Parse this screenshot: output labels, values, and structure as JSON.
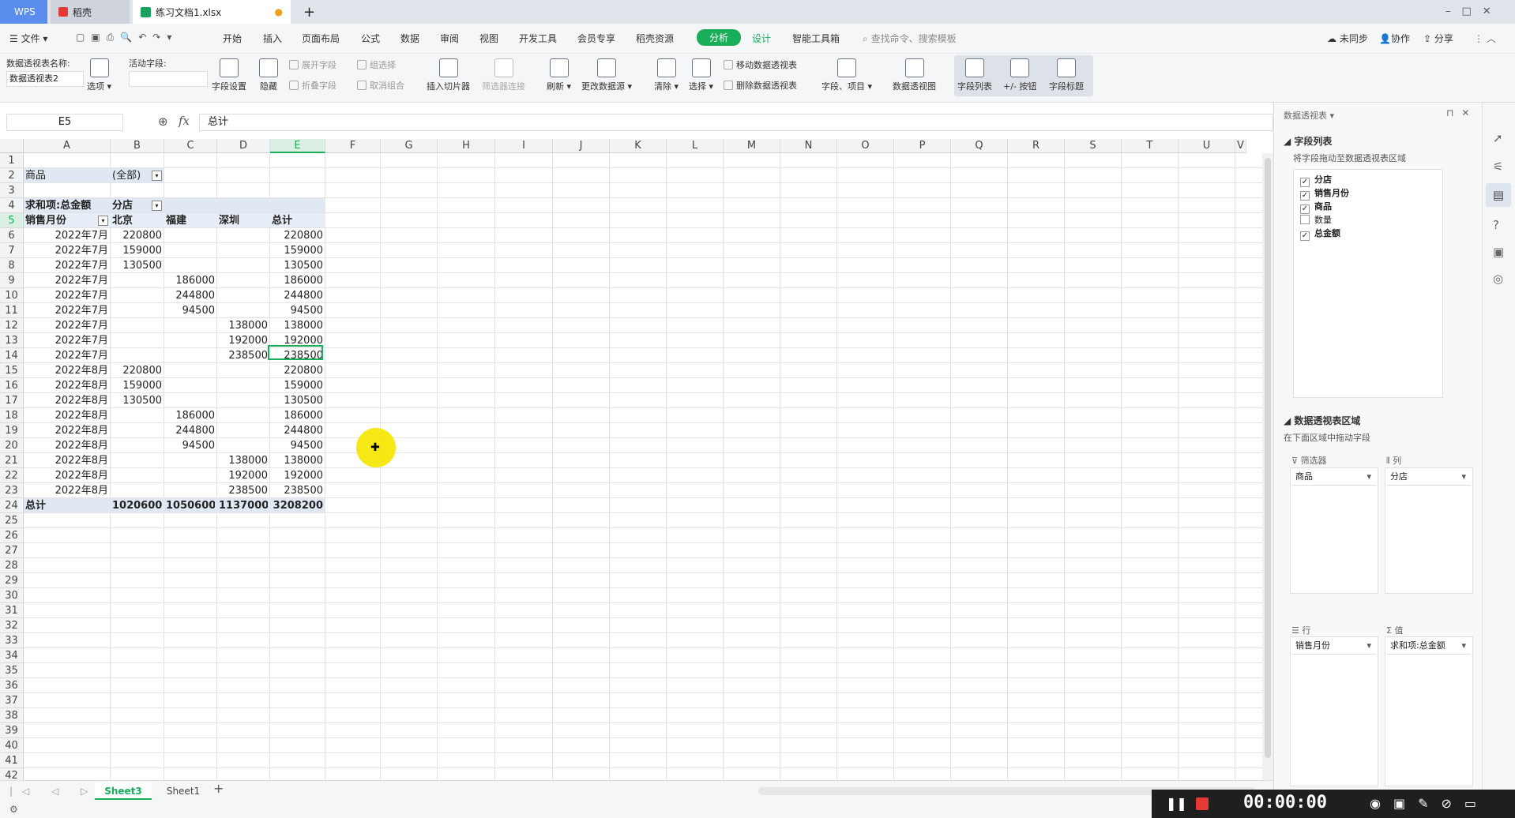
{
  "titlebar": {
    "wps": "WPS",
    "tab_daoke": "稻壳",
    "tab_file": "练习文档1.xlsx",
    "new_tab": "+"
  },
  "menu": {
    "file": "文件",
    "items": [
      "开始",
      "插入",
      "页面布局",
      "公式",
      "数据",
      "审阅",
      "视图",
      "开发工具",
      "会员专享",
      "稻壳资源"
    ],
    "active": "分析",
    "design": "设计",
    "smart": "智能工具箱",
    "search": "查找命令、搜索模板",
    "sync": "未同步",
    "collab": "协作",
    "share": "分享"
  },
  "ribbon": {
    "pt_name_label": "数据透视表名称:",
    "pt_name": "数据透视表2",
    "active_field_label": "活动字段:",
    "options": "选项",
    "field_settings": "字段设置",
    "hide": "隐藏",
    "expand": "展开字段",
    "collapse": "折叠字段",
    "group_sel": "组选择",
    "ungroup": "取消组合",
    "insert_slicer": "插入切片器",
    "filter_conn": "筛选器连接",
    "refresh": "刷新",
    "change_source": "更改数据源",
    "clear": "清除",
    "select": "选择",
    "move_pt": "移动数据透视表",
    "delete_pt": "删除数据透视表",
    "fields_items": "字段、项目",
    "pivot_chart": "数据透视图",
    "field_list": "字段列表",
    "plus_minus": "+/- 按钮",
    "field_headers": "字段标题"
  },
  "formula": {
    "cell_ref": "E5",
    "fx": "fx",
    "value": "总计"
  },
  "columns": [
    "A",
    "B",
    "C",
    "D",
    "E",
    "F",
    "G",
    "H",
    "I",
    "J",
    "K",
    "L",
    "M",
    "N",
    "O",
    "P",
    "Q",
    "R",
    "S",
    "T",
    "U",
    "V"
  ],
  "rows": [
    {
      "r": "1",
      "c": [
        "",
        "",
        "",
        "",
        ""
      ]
    },
    {
      "r": "2",
      "c": [
        "商品",
        "(全部)",
        "",
        "",
        ""
      ]
    },
    {
      "r": "3",
      "c": [
        "",
        "",
        "",
        "",
        ""
      ]
    },
    {
      "r": "4",
      "c": [
        "求和项:总金额",
        "分店",
        "",
        "",
        ""
      ]
    },
    {
      "r": "5",
      "c": [
        "销售月份",
        "北京",
        "福建",
        "深圳",
        "总计"
      ]
    },
    {
      "r": "6",
      "c": [
        "2022年7月",
        "220800",
        "",
        "",
        "220800"
      ]
    },
    {
      "r": "7",
      "c": [
        "2022年7月",
        "159000",
        "",
        "",
        "159000"
      ]
    },
    {
      "r": "8",
      "c": [
        "2022年7月",
        "130500",
        "",
        "",
        "130500"
      ]
    },
    {
      "r": "9",
      "c": [
        "2022年7月",
        "",
        "186000",
        "",
        "186000"
      ]
    },
    {
      "r": "10",
      "c": [
        "2022年7月",
        "",
        "244800",
        "",
        "244800"
      ]
    },
    {
      "r": "11",
      "c": [
        "2022年7月",
        "",
        "94500",
        "",
        "94500"
      ]
    },
    {
      "r": "12",
      "c": [
        "2022年7月",
        "",
        "",
        "138000",
        "138000"
      ]
    },
    {
      "r": "13",
      "c": [
        "2022年7月",
        "",
        "",
        "192000",
        "192000"
      ]
    },
    {
      "r": "14",
      "c": [
        "2022年7月",
        "",
        "",
        "238500",
        "238500"
      ]
    },
    {
      "r": "15",
      "c": [
        "2022年8月",
        "220800",
        "",
        "",
        "220800"
      ]
    },
    {
      "r": "16",
      "c": [
        "2022年8月",
        "159000",
        "",
        "",
        "159000"
      ]
    },
    {
      "r": "17",
      "c": [
        "2022年8月",
        "130500",
        "",
        "",
        "130500"
      ]
    },
    {
      "r": "18",
      "c": [
        "2022年8月",
        "",
        "186000",
        "",
        "186000"
      ]
    },
    {
      "r": "19",
      "c": [
        "2022年8月",
        "",
        "244800",
        "",
        "244800"
      ]
    },
    {
      "r": "20",
      "c": [
        "2022年8月",
        "",
        "94500",
        "",
        "94500"
      ]
    },
    {
      "r": "21",
      "c": [
        "2022年8月",
        "",
        "",
        "138000",
        "138000"
      ]
    },
    {
      "r": "22",
      "c": [
        "2022年8月",
        "",
        "",
        "192000",
        "192000"
      ]
    },
    {
      "r": "23",
      "c": [
        "2022年8月",
        "",
        "",
        "238500",
        "238500"
      ]
    },
    {
      "r": "24",
      "c": [
        "总计",
        "1020600",
        "1050600",
        "1137000",
        "3208200"
      ]
    }
  ],
  "empty_rows": [
    "25",
    "26",
    "27",
    "28",
    "29",
    "30",
    "31",
    "32",
    "33",
    "34",
    "35",
    "36",
    "37",
    "38",
    "39",
    "40",
    "41",
    "42"
  ],
  "sheets": {
    "active": "Sheet3",
    "other": "Sheet1",
    "add": "+"
  },
  "pane": {
    "title": "数据透视表",
    "field_list": "字段列表",
    "drag_hint": "将字段拖动至数据透视表区域",
    "fields": [
      {
        "name": "分店",
        "checked": true
      },
      {
        "name": "销售月份",
        "checked": true
      },
      {
        "name": "商品",
        "checked": true
      },
      {
        "name": "数量",
        "checked": false
      },
      {
        "name": "总金额",
        "checked": true
      }
    ],
    "area_title": "数据透视表区域",
    "area_hint": "在下面区域中拖动字段",
    "filters_label": "筛选器",
    "columns_label": "列",
    "rows_label": "行",
    "values_label": "值",
    "filter_field": "商品",
    "column_field": "分店",
    "row_field": "销售月份",
    "value_field": "求和项:总金额"
  },
  "recorder": {
    "time": "00:00:00"
  }
}
